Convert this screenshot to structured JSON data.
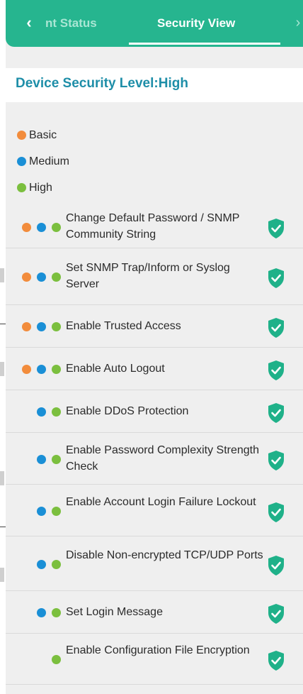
{
  "tabs": {
    "prev_icon": "chevron-left-icon",
    "status_label": "nt Status",
    "security_label": "Security View",
    "next_icon": "chevron-right-icon"
  },
  "title": "Device Security Level:High",
  "legend": [
    {
      "level": "basic",
      "label": "Basic"
    },
    {
      "level": "medium",
      "label": "Medium"
    },
    {
      "level": "high",
      "label": "High"
    }
  ],
  "items": [
    {
      "label": "Change Default Password / SNMP Community String",
      "levels": [
        "basic",
        "medium",
        "high"
      ],
      "status_icon": "shield-check-icon"
    },
    {
      "label": "Set SNMP Trap/Inform or Syslog Server",
      "levels": [
        "basic",
        "medium",
        "high"
      ],
      "status_icon": "shield-check-icon"
    },
    {
      "label": "Enable Trusted Access",
      "levels": [
        "basic",
        "medium",
        "high"
      ],
      "status_icon": "shield-check-icon"
    },
    {
      "label": "Enable Auto Logout",
      "levels": [
        "basic",
        "medium",
        "high"
      ],
      "status_icon": "shield-check-icon"
    },
    {
      "label": "Enable DDoS Protection",
      "levels": [
        "medium",
        "high"
      ],
      "status_icon": "shield-check-icon"
    },
    {
      "label": "Enable Password Complexity Strength Check",
      "levels": [
        "medium",
        "high"
      ],
      "status_icon": "shield-check-icon"
    },
    {
      "label": "Enable Account Login Failure Lockout",
      "levels": [
        "medium",
        "high"
      ],
      "status_icon": "shield-check-icon"
    },
    {
      "label": "Disable Non-encrypted TCP/UDP Ports",
      "levels": [
        "medium",
        "high"
      ],
      "status_icon": "shield-check-icon"
    },
    {
      "label": "Set Login Message",
      "levels": [
        "medium",
        "high"
      ],
      "status_icon": "shield-check-icon"
    },
    {
      "label": "Enable Configuration File Encryption",
      "levels": [
        "high"
      ],
      "status_icon": "shield-check-icon"
    }
  ],
  "colors": {
    "header": "#26b58f",
    "title_text": "#1e8ea8",
    "basic": "#f28c3c",
    "medium": "#1a8fd6",
    "high": "#7bbf3e",
    "shield": "#1fb189"
  }
}
